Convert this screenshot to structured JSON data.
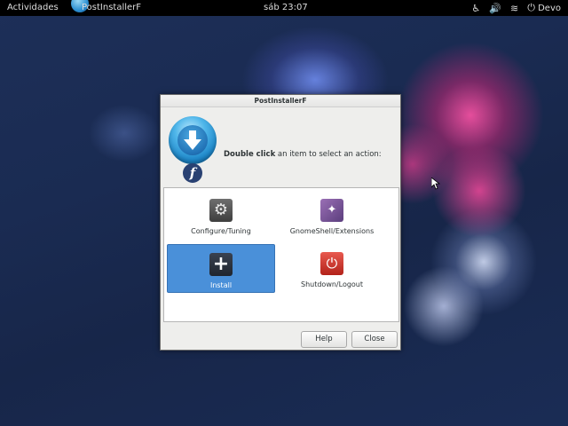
{
  "topbar": {
    "activities": "Actividades",
    "app_name": "PostInstallerF",
    "clock": "sáb 23:07",
    "user": "Devo",
    "icons": [
      "accessibility-icon",
      "volume-icon",
      "wifi-icon",
      "user-icon"
    ]
  },
  "dialog": {
    "title": "PostInstallerF",
    "prompt_bold": "Double click",
    "prompt_rest": " an item to select an action:",
    "items": [
      {
        "label": "Configure/Tuning",
        "icon": "gear-icon",
        "selected": false
      },
      {
        "label": "GnomeShell/Extensions",
        "icon": "gnome-shell-icon",
        "selected": false
      },
      {
        "label": "Install",
        "icon": "plus-icon",
        "selected": true
      },
      {
        "label": "Shutdown/Logout",
        "icon": "power-icon",
        "selected": false
      }
    ],
    "buttons": {
      "help": "Help",
      "close": "Close"
    }
  },
  "colors": {
    "selection": "#4a90d9",
    "topbar_bg": "#000000",
    "dialog_bg": "#eeeeec"
  }
}
